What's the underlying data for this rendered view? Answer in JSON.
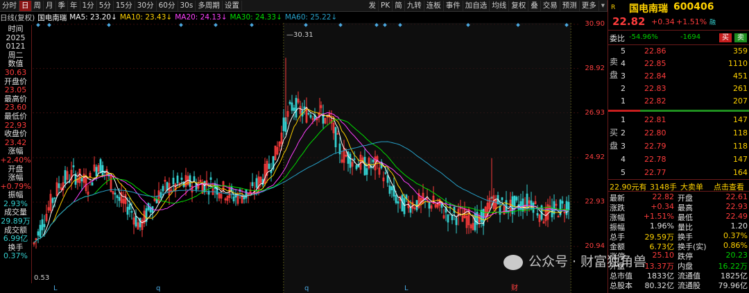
{
  "toolbar": {
    "left_items": [
      "分时",
      "日",
      "周",
      "月",
      "季",
      "年",
      "1分",
      "5分",
      "15分",
      "30分",
      "60分",
      "30s",
      "多周期",
      "设置"
    ],
    "active": "日",
    "right_items": [
      "发",
      "PK",
      "简",
      "九转",
      "连板",
      "事件",
      "加自选",
      "均线",
      "复权",
      "叠",
      "交易",
      "预测",
      "更多"
    ]
  },
  "subheader": {
    "mode": "日线(复权)",
    "stock": "国电南瑞",
    "ma5": "MA5: 23.20↓",
    "ma10": "MA10: 23.43↓",
    "ma20": "MA20: 24.13↓",
    "ma30": "MA30: 24.33↓",
    "ma60": "MA60: 25.22↓"
  },
  "left_panel": [
    {
      "t": "时间",
      "c": "white"
    },
    {
      "t": "2025",
      "c": "white"
    },
    {
      "t": "0121",
      "c": "white"
    },
    {
      "t": "周二",
      "c": "white"
    },
    {
      "t": "数值",
      "c": "white"
    },
    {
      "t": "30.63",
      "c": "red"
    },
    {
      "t": "开盘价",
      "c": "white"
    },
    {
      "t": "23.05",
      "c": "red"
    },
    {
      "t": "最高价",
      "c": "white"
    },
    {
      "t": "23.60",
      "c": "red"
    },
    {
      "t": "最低价",
      "c": "white"
    },
    {
      "t": "22.93",
      "c": "red"
    },
    {
      "t": "收盘价",
      "c": "white"
    },
    {
      "t": "23.42",
      "c": "red"
    },
    {
      "t": "涨幅",
      "c": "white"
    },
    {
      "t": "+2.40%",
      "c": "red"
    },
    {
      "t": "开盘",
      "c": "white"
    },
    {
      "t": "涨幅",
      "c": "white"
    },
    {
      "t": "+0.79%",
      "c": "red"
    },
    {
      "t": "振幅",
      "c": "white"
    },
    {
      "t": "2.93%",
      "c": "cyan"
    },
    {
      "t": "成交量",
      "c": "white"
    },
    {
      "t": "29.89万",
      "c": "cyan"
    },
    {
      "t": "成交额",
      "c": "white"
    },
    {
      "t": "6.99亿",
      "c": "cyan"
    },
    {
      "t": "换手",
      "c": "white"
    },
    {
      "t": "0.37%",
      "c": "cyan"
    }
  ],
  "price_axis": [
    "30.90",
    "28.92",
    "26.93",
    "24.92",
    "22.93",
    "20.94"
  ],
  "chart_annotations": {
    "high_label": "30.31",
    "low_label": "0.53",
    "bottom_markers": [
      "L",
      "q",
      "q",
      "L",
      "财"
    ]
  },
  "quote": {
    "market_tag": "R",
    "name": "国电南瑞",
    "code": "600406",
    "price": "22.82",
    "change": "+0.34",
    "change_pct": "+1.51%",
    "badge": "融",
    "weibi_label": "委比",
    "weibi_pct": "-54.96%",
    "weibi_diff": "-1694",
    "buy_btn": "买",
    "sell_btn": "卖",
    "sell_label": "卖盘",
    "buy_label": "买盘",
    "asks": [
      {
        "lvl": "5",
        "price": "22.86",
        "vol": "359"
      },
      {
        "lvl": "4",
        "price": "22.85",
        "vol": "1110"
      },
      {
        "lvl": "3",
        "price": "22.84",
        "vol": "451"
      },
      {
        "lvl": "2",
        "price": "22.83",
        "vol": "261"
      },
      {
        "lvl": "1",
        "price": "22.82",
        "vol": "207"
      }
    ],
    "bids": [
      {
        "lvl": "1",
        "price": "22.81",
        "vol": "147"
      },
      {
        "lvl": "2",
        "price": "22.80",
        "vol": "118"
      },
      {
        "lvl": "3",
        "price": "22.79",
        "vol": "118"
      },
      {
        "lvl": "4",
        "price": "22.78",
        "vol": "147"
      },
      {
        "lvl": "5",
        "price": "22.77",
        "vol": "164"
      }
    ],
    "bigorder": {
      "price": "22.90元有",
      "qty": "3148手",
      "label": "大卖单",
      "link": "点击查看"
    },
    "stats": [
      {
        "l1": "最新",
        "v1": "22.82",
        "c1": "red",
        "l2": "开盘",
        "v2": "22.61",
        "c2": "red"
      },
      {
        "l1": "涨跌",
        "v1": "+0.34",
        "c1": "red",
        "l2": "最高",
        "v2": "22.93",
        "c2": "red"
      },
      {
        "l1": "涨幅",
        "v1": "+1.51%",
        "c1": "red",
        "l2": "最低",
        "v2": "22.49",
        "c2": "red"
      },
      {
        "l1": "振幅",
        "v1": "1.96%",
        "c1": "white",
        "l2": "量比",
        "v2": "1.20",
        "c2": "white"
      },
      {
        "l1": "总手",
        "v1": "29.59万",
        "c1": "yellow",
        "l2": "换手",
        "v2": "0.37%",
        "c2": "yellow"
      },
      {
        "l1": "金额",
        "v1": "6.73亿",
        "c1": "yellow",
        "l2": "换手(实)",
        "v2": "0.86%",
        "c2": "yellow"
      },
      {
        "l1": "涨停",
        "v1": "25.10",
        "c1": "red",
        "l2": "跌停",
        "v2": "20.23",
        "c2": "green"
      },
      {
        "l1": "外盘",
        "v1": "13.37万",
        "c1": "red",
        "l2": "内盘",
        "v2": "16.22万",
        "c2": "green"
      },
      {
        "l1": "总市值",
        "v1": "1833亿",
        "c1": "white",
        "l2": "流通值",
        "v2": "1825亿",
        "c2": "white"
      },
      {
        "l1": "总股本",
        "v1": "80.32亿",
        "c1": "white",
        "l2": "流通股",
        "v2": "79.96亿",
        "c2": "white"
      }
    ]
  },
  "watermark": "公众号 · 财富独角兽",
  "colors": {
    "up": "#ff3c3c",
    "down": "#35d0d0",
    "ma5": "#ffffff",
    "ma10": "#ffd200",
    "ma20": "#ff40ff",
    "ma30": "#00e000",
    "ma60": "#27a0c8"
  }
}
